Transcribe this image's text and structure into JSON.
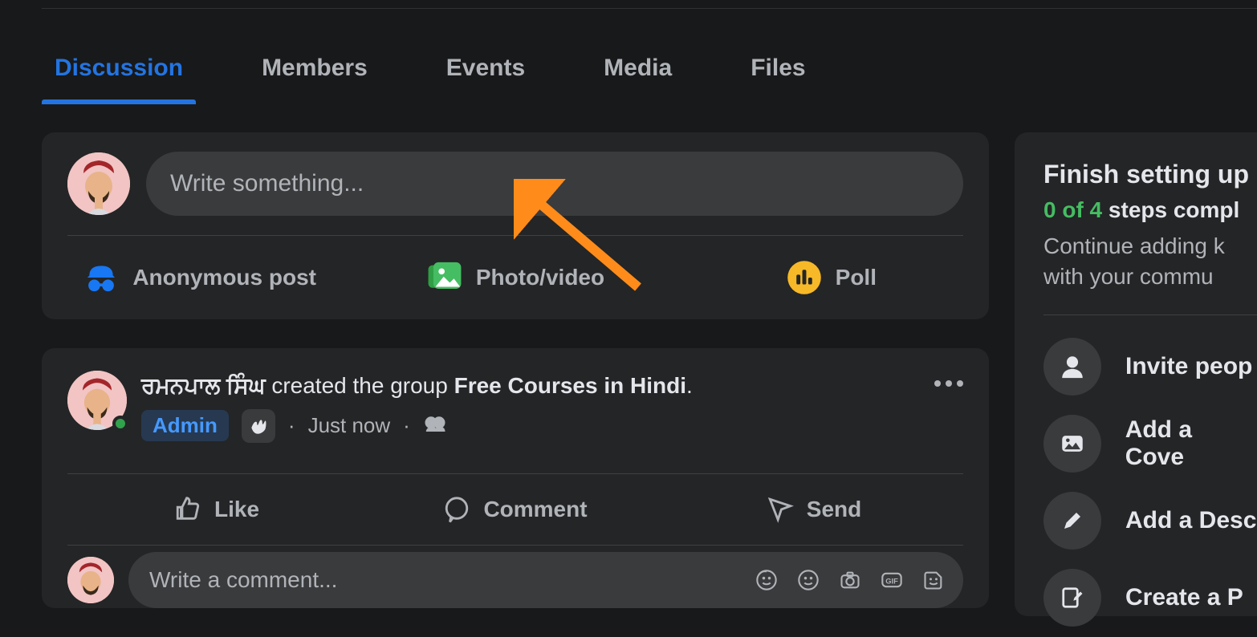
{
  "tabs": {
    "discussion": "Discussion",
    "members": "Members",
    "events": "Events",
    "media": "Media",
    "files": "Files"
  },
  "compose": {
    "placeholder": "Write something...",
    "anonymous_label": "Anonymous post",
    "photo_label": "Photo/video",
    "poll_label": "Poll"
  },
  "post": {
    "author_name": "ਰਮਨਪਾਲ ਸਿੰਘ",
    "created_text": " created the group ",
    "group_name": "Free Courses in Hindi",
    "period": ".",
    "admin_badge": "Admin",
    "time": "Just now",
    "actions": {
      "like": "Like",
      "comment": "Comment",
      "send": "Send"
    },
    "comment_placeholder": "Write a comment..."
  },
  "right_panel": {
    "title": "Finish setting up",
    "steps_left": "0 of 4",
    "steps_right": " steps compl",
    "desc_line_1": "Continue adding k",
    "desc_line_2": "with your commu",
    "items": {
      "invite": "Invite peop",
      "cover": "Add a Cove",
      "desc": "Add a Desc",
      "create": "Create a P"
    }
  }
}
